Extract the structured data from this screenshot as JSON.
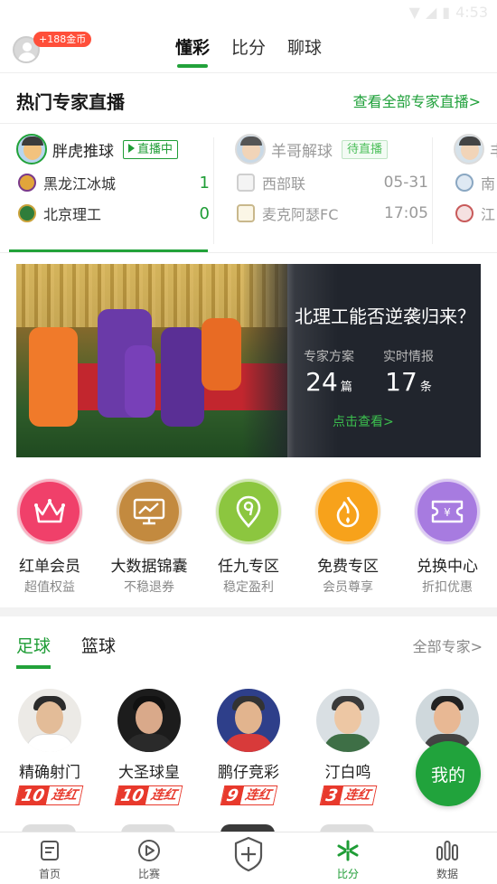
{
  "status_bar": {
    "time": "4:53"
  },
  "top_nav": {
    "coin_badge": "+188金币",
    "tabs": [
      {
        "label": "懂彩",
        "active": true
      },
      {
        "label": "比分",
        "active": false
      },
      {
        "label": "聊球",
        "active": false
      }
    ]
  },
  "live_section": {
    "title": "热门专家直播",
    "more_link": "查看全部专家直播>",
    "cards": [
      {
        "expert": "胖虎推球",
        "status": "直播中",
        "home": "黑龙江冰城",
        "away": "北京理工",
        "home_value": "1",
        "away_value": "0"
      },
      {
        "expert": "羊哥解球",
        "status": "待直播",
        "home": "西部联",
        "away": "麦克阿瑟FC",
        "home_value": "05-31",
        "away_value": "17:05"
      },
      {
        "expert": "丰",
        "home": "南",
        "away": "江"
      }
    ]
  },
  "banner": {
    "headline": "北理工能否逆袭归来？",
    "stat1_label": "专家方案",
    "stat1_value": "24",
    "stat1_unit": "篇",
    "stat2_label": "实时情报",
    "stat2_value": "17",
    "stat2_unit": "条",
    "cta": "点击查看>"
  },
  "features": [
    {
      "label": "红单会员",
      "sub": "超值权益",
      "color": "#f0406a",
      "icon": "crown-icon"
    },
    {
      "label": "大数据锦囊",
      "sub": "不稳退券",
      "color": "#c38a3f",
      "icon": "chart-icon"
    },
    {
      "label": "任九专区",
      "sub": "稳定盈利",
      "color": "#8cc63f",
      "icon": "nine-icon"
    },
    {
      "label": "免费专区",
      "sub": "会员尊享",
      "color": "#f7a21b",
      "icon": "flame-icon"
    },
    {
      "label": "兑换中心",
      "sub": "折扣优惠",
      "color": "#a77be0",
      "icon": "ticket-icon"
    }
  ],
  "sport_tabs": {
    "football": "足球",
    "basketball": "篮球",
    "all_experts": "全部专家>"
  },
  "experts": [
    {
      "name": "精确射门",
      "streak": "10",
      "streak_label": "连红"
    },
    {
      "name": "大圣球皇",
      "streak": "10",
      "streak_label": "连红"
    },
    {
      "name": "鹏仔竞彩",
      "streak": "9",
      "streak_label": "连红"
    },
    {
      "name": "汀白鸣",
      "streak": "3",
      "streak_label": "连红"
    },
    {
      "name": "",
      "streak": "",
      "streak_label": ""
    }
  ],
  "my_button": "我的",
  "bottom_nav": [
    {
      "label": "首页",
      "icon": "home-icon"
    },
    {
      "label": "比赛",
      "icon": "play-icon"
    },
    {
      "label": "",
      "icon": "plus-shield-icon"
    },
    {
      "label": "比分",
      "icon": "score-icon",
      "active": true
    },
    {
      "label": "数据",
      "icon": "data-icon"
    }
  ]
}
